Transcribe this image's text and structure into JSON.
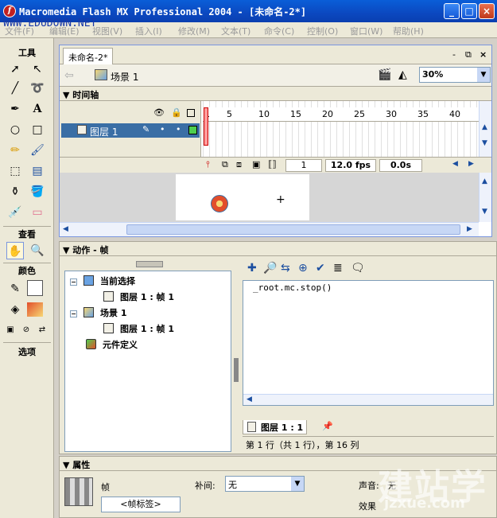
{
  "window": {
    "title": "Macromedia Flash MX Professional 2004 - [未命名-2*]",
    "watermark_url": "WWW.EDUDOWN.NET",
    "buttons": {
      "minimize": "_",
      "maximize": "□",
      "close": "×"
    }
  },
  "menu": [
    "文件(F)",
    "编辑(E)",
    "视图(V)",
    "插入(I)",
    "修改(M)",
    "文本(T)",
    "命令(C)",
    "控制(O)",
    "窗口(W)",
    "帮助(H)"
  ],
  "tools": {
    "header": "工具",
    "view_header": "查看",
    "colors_header": "颜色",
    "options_header": "选项"
  },
  "document": {
    "tab_title": "未命名-2*",
    "scene_label": "场景 1",
    "zoom": "30%",
    "tab_controls": {
      "minimize": "-",
      "restore": "⧉",
      "close": "×"
    }
  },
  "timeline": {
    "header": "时间轴",
    "layer_name": "图层 1",
    "frame_numbers": [
      "1",
      "5",
      "10",
      "15",
      "20",
      "25",
      "30",
      "35",
      "40"
    ],
    "current_frame": "1",
    "fps": "12.0 fps",
    "elapsed": "0.0s"
  },
  "actions": {
    "header": "动作 - 帧",
    "tree": {
      "current_selection": "当前选择",
      "current_frame_item": "图层 1 : 帧 1",
      "scene": "场景 1",
      "scene_frame_item": "图层 1 : 帧 1",
      "symbol_defs": "元件定义"
    },
    "code": "_root.mc.stop()",
    "layer_tab": "图层 1 : 1",
    "status": "第 1 行（共 1 行），第 16 列"
  },
  "properties": {
    "header": "属性",
    "type_label": "帧",
    "frame_label_button": "<帧标签>",
    "tween_label": "补间:",
    "tween_value": "无",
    "sound_label": "声音:",
    "sound_value": "无",
    "effect_label": "效果"
  },
  "watermark": {
    "text": "建站学",
    "domain": "jzxue.com"
  }
}
